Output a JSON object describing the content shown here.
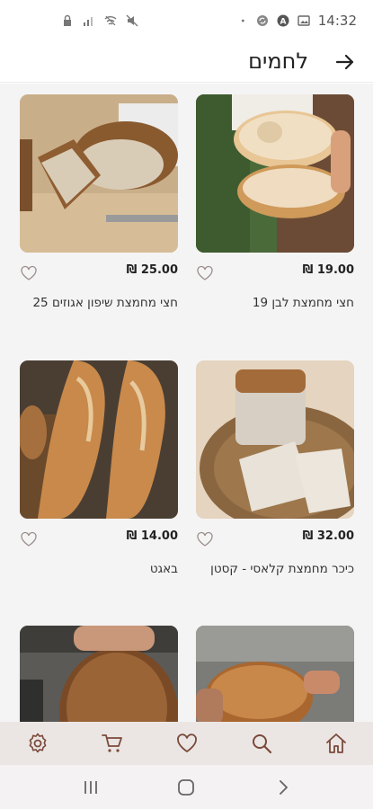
{
  "status_bar": {
    "time": "14:32",
    "icons_left": [
      "lock-icon",
      "signal-icon",
      "wifi-icon",
      "mute-icon"
    ],
    "icons_right": [
      "dot-icon",
      "sync-icon",
      "a-badge-icon",
      "image-icon"
    ]
  },
  "header": {
    "title": "לחמים",
    "back_icon": "arrow-right-icon"
  },
  "products": [
    {
      "name": "חצי מחמצת לבן 19",
      "price": "19.00 ₪"
    },
    {
      "name": "חצי מחמצת שיפון אגוזים 25",
      "price": "25.00 ₪"
    },
    {
      "name": "כיכר מחמצת קלאסי - קסטן",
      "price": "32.00 ₪"
    },
    {
      "name": "באגט",
      "price": "14.00 ₪"
    },
    {
      "name": "",
      "price": ""
    },
    {
      "name": "",
      "price": ""
    }
  ],
  "bottom_nav": {
    "items": [
      "home-icon",
      "search-icon",
      "heart-icon",
      "cart-icon",
      "settings-icon"
    ],
    "accent": "#7a4a3a"
  },
  "system_nav": [
    "recent-apps-icon",
    "home-circle-icon",
    "back-chevron-icon"
  ]
}
